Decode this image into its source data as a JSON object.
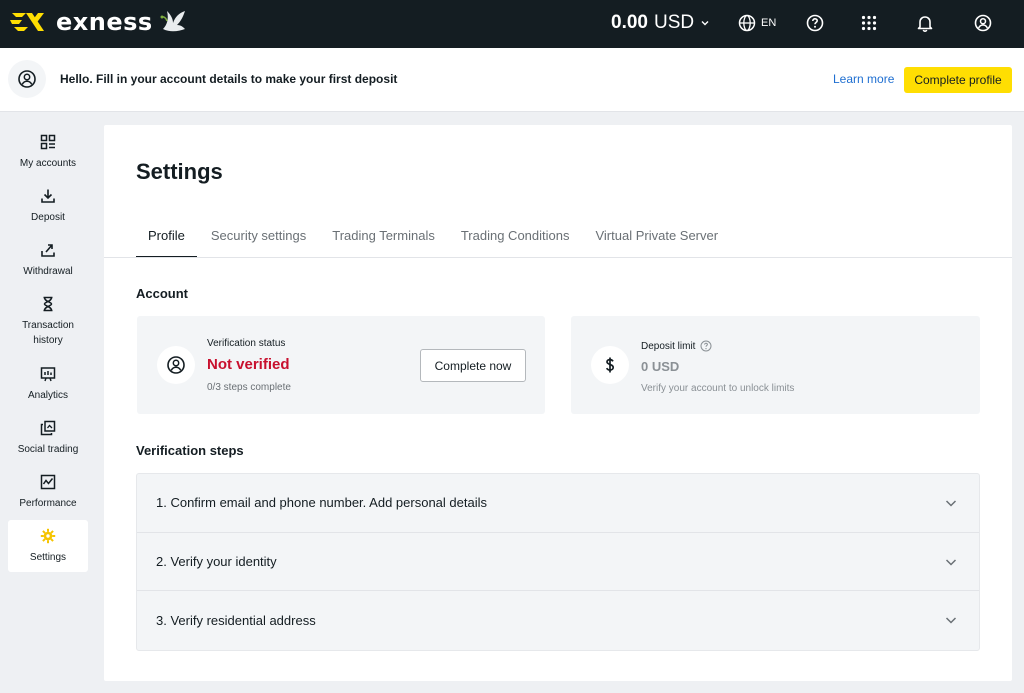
{
  "header": {
    "brand": "exness",
    "balance_amount": "0.00",
    "balance_currency": "USD",
    "language": "EN",
    "icons": [
      "globe-icon",
      "help-icon",
      "apps-grid-icon",
      "bell-icon",
      "user-icon"
    ]
  },
  "notice": {
    "message": "Hello. Fill in your account details to make your first deposit",
    "learn_more": "Learn more",
    "complete_profile": "Complete profile"
  },
  "sidebar": {
    "items": [
      {
        "label": "My accounts",
        "icon": "accounts-icon"
      },
      {
        "label": "Deposit",
        "icon": "deposit-icon"
      },
      {
        "label": "Withdrawal",
        "icon": "withdrawal-icon"
      },
      {
        "label": "Transaction history",
        "icon": "hourglass-icon"
      },
      {
        "label": "Analytics",
        "icon": "analytics-icon"
      },
      {
        "label": "Social trading",
        "icon": "social-trading-icon"
      },
      {
        "label": "Performance",
        "icon": "performance-icon"
      },
      {
        "label": "Settings",
        "icon": "gear-icon",
        "active": true
      }
    ]
  },
  "main": {
    "title": "Settings",
    "tabs": [
      {
        "label": "Profile",
        "active": true
      },
      {
        "label": "Security settings"
      },
      {
        "label": "Trading Terminals"
      },
      {
        "label": "Trading Conditions"
      },
      {
        "label": "Virtual Private Server"
      }
    ],
    "account_title": "Account",
    "verification": {
      "label": "Verification status",
      "status": "Not verified",
      "steps": "0/3 steps complete",
      "button": "Complete now"
    },
    "deposit_limit": {
      "label": "Deposit limit",
      "value": "0 USD",
      "hint": "Verify your account to unlock limits"
    },
    "steps_title": "Verification steps",
    "steps": [
      "1. Confirm email and phone number. Add personal details",
      "2. Verify your identity",
      "3. Verify residential address"
    ]
  },
  "colors": {
    "topbar": "#141d22",
    "accent_yellow": "#ffde02",
    "error_red": "#c8102e",
    "link_blue": "#1f6fd1"
  }
}
